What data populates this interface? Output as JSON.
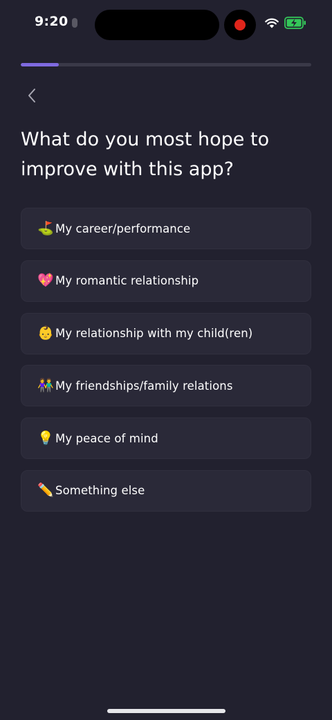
{
  "status_bar": {
    "time": "9:20",
    "icons": [
      "recording-dot",
      "wifi-icon",
      "battery-charging-icon"
    ],
    "recording_color": "#e0251b",
    "battery_color": "#34c759"
  },
  "progress": {
    "fraction": 0.13,
    "color": "#7f6ae0"
  },
  "back_icon": "chevron-left-icon",
  "title": "What do you most hope to improve with this app?",
  "options": [
    {
      "emoji": "⛳",
      "label": "My career/performance"
    },
    {
      "emoji": "💖",
      "label": "My romantic relationship"
    },
    {
      "emoji": "👶",
      "label": "My relationship with my child(ren)"
    },
    {
      "emoji": "👫",
      "label": "My friendships/family relations"
    },
    {
      "emoji": "💡",
      "label": "My peace of mind"
    },
    {
      "emoji": "✏️",
      "label": "Something else"
    }
  ]
}
